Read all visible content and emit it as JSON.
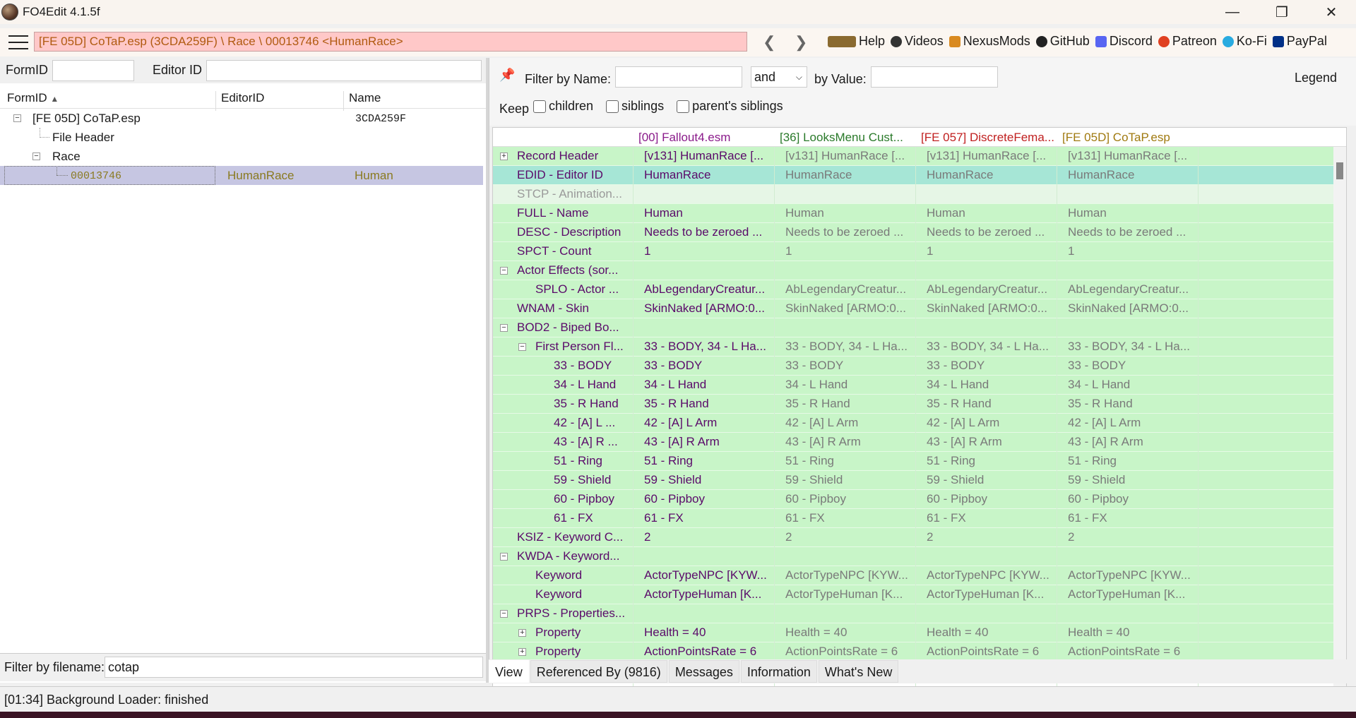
{
  "window": {
    "title": "FO4Edit 4.1.5f"
  },
  "toolbar": {
    "path": "[FE 05D] CoTaP.esp (3CDA259F) \\ Race \\ 00013746 <HumanRace>",
    "links": [
      {
        "label": "Help",
        "icon": "book-icon",
        "color": "#8a6a30"
      },
      {
        "label": "Videos",
        "icon": "video-icon",
        "color": "#333333"
      },
      {
        "label": "NexusMods",
        "icon": "nexus-icon",
        "color": "#d98a20"
      },
      {
        "label": "GitHub",
        "icon": "github-icon",
        "color": "#222222"
      },
      {
        "label": "Discord",
        "icon": "discord-icon",
        "color": "#5865f2"
      },
      {
        "label": "Patreon",
        "icon": "patreon-icon",
        "color": "#e04020"
      },
      {
        "label": "Ko-Fi",
        "icon": "kofi-icon",
        "color": "#29abe0"
      },
      {
        "label": "PayPal",
        "icon": "paypal-icon",
        "color": "#003087"
      }
    ]
  },
  "left": {
    "formid_label": "FormID",
    "editorid_label": "Editor ID",
    "columns": [
      "FormID",
      "EditorID",
      "Name"
    ],
    "tree": [
      {
        "formid": "[FE 05D] CoTaP.esp",
        "editorid": "",
        "name": "3CDA259F"
      },
      {
        "formid": "File Header",
        "editorid": "",
        "name": ""
      },
      {
        "formid": "Race",
        "editorid": "",
        "name": ""
      },
      {
        "formid": "00013746",
        "editorid": "HumanRace",
        "name": "Human"
      }
    ],
    "filter_label": "Filter by filename:",
    "filter_value": "cotap"
  },
  "right": {
    "filter_name_label": "Filter by Name:",
    "and_option": "and",
    "by_value_label": "by Value:",
    "legend": "Legend",
    "keep_label": "Keep",
    "checks": [
      "children",
      "siblings",
      "parent's siblings"
    ],
    "columns": [
      {
        "label": "[00] Fallout4.esm",
        "color": "#8a1a8a"
      },
      {
        "label": "[36] LooksMenu Cust...",
        "color": "#2a7a2a"
      },
      {
        "label": "[FE 057] DiscreteFema...",
        "color": "#c02020"
      },
      {
        "label": "[FE 05D] CoTaP.esp",
        "color": "#a07a10"
      }
    ],
    "rows": [
      {
        "name": "Record Header",
        "values": [
          "[v131] HumanRace [...",
          "[v131] HumanRace [...",
          "[v131] HumanRace [...",
          "[v131] HumanRace [..."
        ]
      },
      {
        "name": "EDID - Editor ID",
        "values": [
          "HumanRace",
          "HumanRace",
          "HumanRace",
          "HumanRace"
        ]
      },
      {
        "name": "STCP - Animation...",
        "values": [
          "",
          "",
          "",
          ""
        ]
      },
      {
        "name": "FULL - Name",
        "values": [
          "Human",
          "Human",
          "Human",
          "Human"
        ]
      },
      {
        "name": "DESC - Description",
        "values": [
          "Needs to be zeroed ...",
          "Needs to be zeroed ...",
          "Needs to be zeroed ...",
          "Needs to be zeroed ..."
        ]
      },
      {
        "name": "SPCT - Count",
        "values": [
          "1",
          "1",
          "1",
          "1"
        ]
      },
      {
        "name": "Actor Effects (sor...",
        "values": [
          "",
          "",
          "",
          ""
        ]
      },
      {
        "name": "SPLO - Actor ...",
        "values": [
          "AbLegendaryCreatur...",
          "AbLegendaryCreatur...",
          "AbLegendaryCreatur...",
          "AbLegendaryCreatur..."
        ]
      },
      {
        "name": "WNAM - Skin",
        "values": [
          "SkinNaked [ARMO:0...",
          "SkinNaked [ARMO:0...",
          "SkinNaked [ARMO:0...",
          "SkinNaked [ARMO:0..."
        ]
      },
      {
        "name": "BOD2 - Biped Bo...",
        "values": [
          "",
          "",
          "",
          ""
        ]
      },
      {
        "name": "First Person Fl...",
        "values": [
          "33 - BODY, 34 - L Ha...",
          "33 - BODY, 34 - L Ha...",
          "33 - BODY, 34 - L Ha...",
          "33 - BODY, 34 - L Ha..."
        ]
      },
      {
        "name": "33 - BODY",
        "values": [
          "33 - BODY",
          "33 - BODY",
          "33 - BODY",
          "33 - BODY"
        ]
      },
      {
        "name": "34 - L Hand",
        "values": [
          "34 - L Hand",
          "34 - L Hand",
          "34 - L Hand",
          "34 - L Hand"
        ]
      },
      {
        "name": "35 - R Hand",
        "values": [
          "35 - R Hand",
          "35 - R Hand",
          "35 - R Hand",
          "35 - R Hand"
        ]
      },
      {
        "name": "42 - [A] L ...",
        "values": [
          "42 - [A] L Arm",
          "42 - [A] L Arm",
          "42 - [A] L Arm",
          "42 - [A] L Arm"
        ]
      },
      {
        "name": "43 - [A] R ...",
        "values": [
          "43 - [A] R Arm",
          "43 - [A] R Arm",
          "43 - [A] R Arm",
          "43 - [A] R Arm"
        ]
      },
      {
        "name": "51 - Ring",
        "values": [
          "51 - Ring",
          "51 - Ring",
          "51 - Ring",
          "51 - Ring"
        ]
      },
      {
        "name": "59 - Shield",
        "values": [
          "59 - Shield",
          "59 - Shield",
          "59 - Shield",
          "59 - Shield"
        ]
      },
      {
        "name": "60 - Pipboy",
        "values": [
          "60 - Pipboy",
          "60 - Pipboy",
          "60 - Pipboy",
          "60 - Pipboy"
        ]
      },
      {
        "name": "61 - FX",
        "values": [
          "61 - FX",
          "61 - FX",
          "61 - FX",
          "61 - FX"
        ]
      },
      {
        "name": "KSIZ - Keyword C...",
        "values": [
          "2",
          "2",
          "2",
          "2"
        ]
      },
      {
        "name": "KWDA - Keyword...",
        "values": [
          "",
          "",
          "",
          ""
        ]
      },
      {
        "name": "Keyword",
        "values": [
          "ActorTypeNPC [KYW...",
          "ActorTypeNPC [KYW...",
          "ActorTypeNPC [KYW...",
          "ActorTypeNPC [KYW..."
        ]
      },
      {
        "name": "Keyword",
        "values": [
          "ActorTypeHuman [K...",
          "ActorTypeHuman [K...",
          "ActorTypeHuman [K...",
          "ActorTypeHuman [K..."
        ]
      },
      {
        "name": "PRPS - Properties...",
        "values": [
          "",
          "",
          "",
          ""
        ]
      },
      {
        "name": "Property",
        "values": [
          "Health = 40",
          "Health = 40",
          "Health = 40",
          "Health = 40"
        ]
      },
      {
        "name": "Property",
        "values": [
          "ActionPointsRate = 6",
          "ActionPointsRate = 6",
          "ActionPointsRate = 6",
          "ActionPointsRate = 6"
        ]
      }
    ]
  },
  "tabs": [
    "View",
    "Referenced By (9816)",
    "Messages",
    "Information",
    "What's New"
  ],
  "status": "[01:34] Background Loader: finished"
}
